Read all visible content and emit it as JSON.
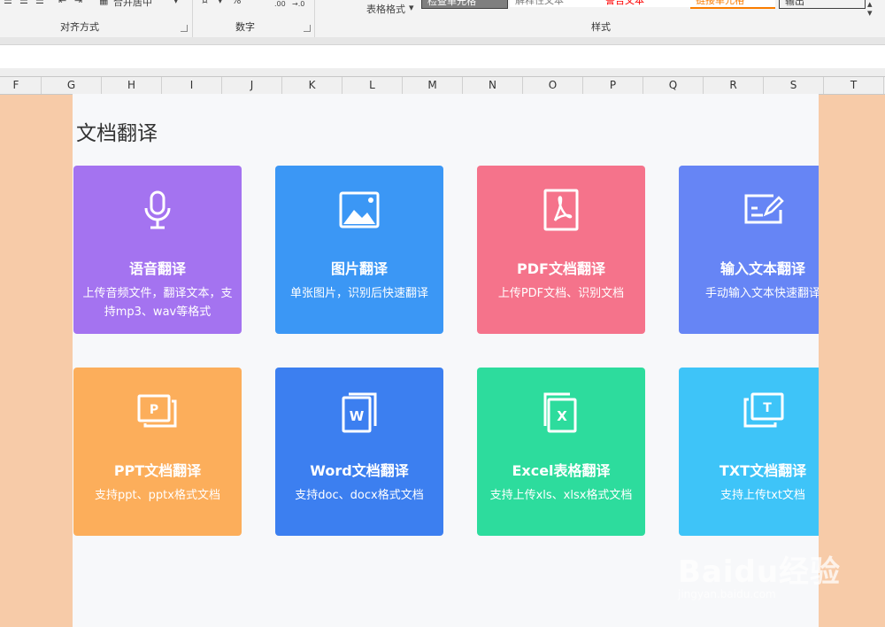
{
  "ribbon": {
    "merge_center_label": "合并居中",
    "table_format_label": "表格格式",
    "groups": {
      "alignment": "对齐方式",
      "number": "数字",
      "styles": "样式"
    },
    "number_formats": [
      ".00",
      "→.0"
    ],
    "percent_symbol": "%",
    "cell_styles": [
      {
        "label": "检查单元格",
        "color": "#ffffff",
        "bg": "#7f7f7f"
      },
      {
        "label": "解释性文本",
        "color": "#7f7f7f",
        "bg": "#ffffff"
      },
      {
        "label": "警告文本",
        "color": "#ff0000",
        "bg": "#ffffff"
      },
      {
        "label": "链接单元格",
        "color": "#fa7d00",
        "bg": "#ffffff"
      },
      {
        "label": "输出",
        "color": "#3f3f3f",
        "bg": "#f2f2f2"
      }
    ]
  },
  "columns": [
    "F",
    "G",
    "H",
    "I",
    "J",
    "K",
    "L",
    "M",
    "N",
    "O",
    "P",
    "Q",
    "R",
    "S",
    "T"
  ],
  "page_title": "文档翻译",
  "cards": [
    {
      "title": "语音翻译",
      "desc": "上传音频文件，翻译文本，支持mp3、wav等格式",
      "color": "#a473f0",
      "icon": "microphone-icon"
    },
    {
      "title": "图片翻译",
      "desc": "单张图片，识别后快速翻译",
      "color": "#3b97f5",
      "icon": "image-icon"
    },
    {
      "title": "PDF文档翻译",
      "desc": "上传PDF文档、识别文档",
      "color": "#f5738b",
      "icon": "pdf-icon"
    },
    {
      "title": "输入文本翻译",
      "desc": "手动输入文本快速翻译",
      "color": "#6685f5",
      "icon": "edit-icon"
    },
    {
      "title": "PPT文档翻译",
      "desc": "支持ppt、pptx格式文档",
      "color": "#fcae5b",
      "icon": "ppt-icon"
    },
    {
      "title": "Word文档翻译",
      "desc": "支持doc、docx格式文档",
      "color": "#3c7ff0",
      "icon": "word-icon"
    },
    {
      "title": "Excel表格翻译",
      "desc": "支持上传xls、xlsx格式文档",
      "color": "#2ddc9d",
      "icon": "excel-icon"
    },
    {
      "title": "TXT文档翻译",
      "desc": "支持上传txt文档",
      "color": "#3ec4f8",
      "icon": "txt-icon"
    }
  ],
  "watermark": {
    "main": "Baidu经验",
    "url": "jingyan.baidu.com"
  }
}
